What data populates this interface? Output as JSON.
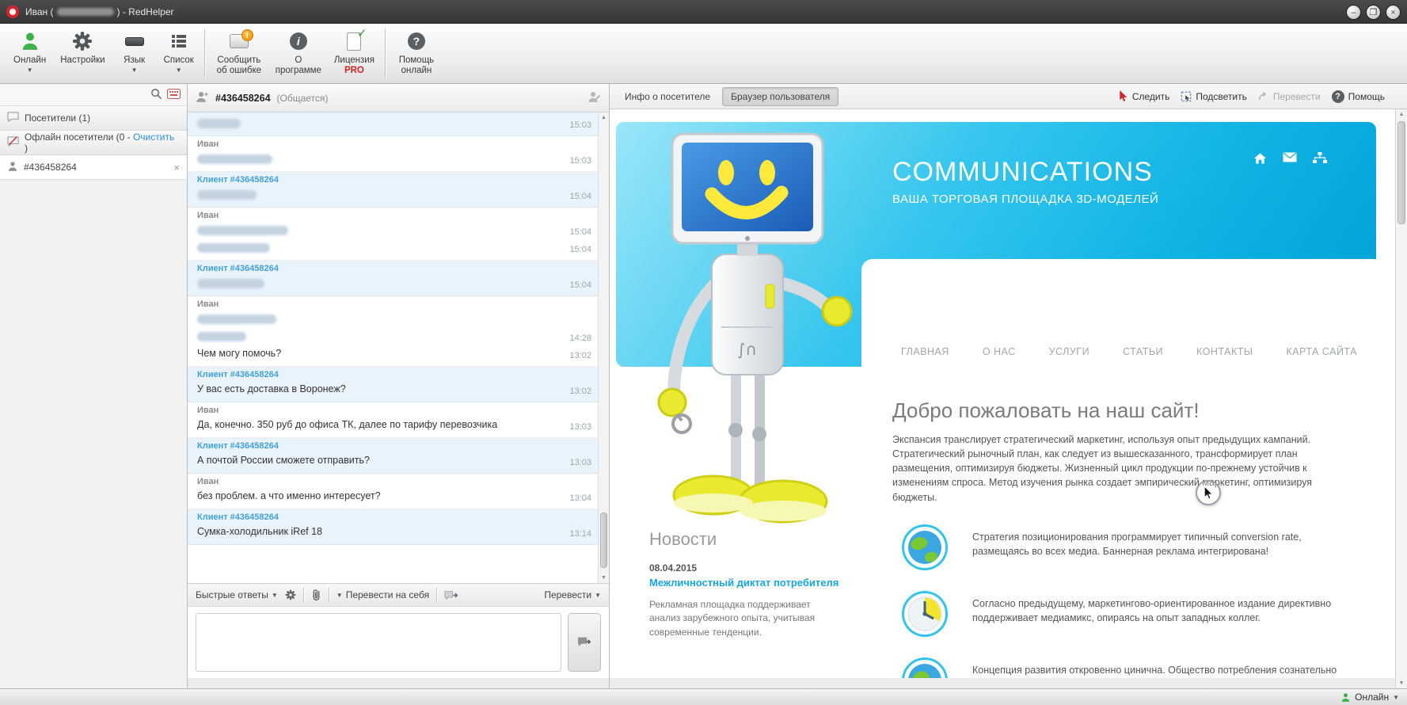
{
  "window": {
    "title_prefix": "Иван (",
    "title_suffix": ") - RedHelper",
    "minimize": "–",
    "maximize": "❒",
    "close": "×"
  },
  "toolbar": {
    "buttons": {
      "online": "Онлайн",
      "settings": "Настройки",
      "language": "Язык",
      "list": "Список",
      "report_error": "Сообщить об ошибке",
      "about": "О программе",
      "license": "Лицензия",
      "license_pro": "PRO",
      "help_online": "Помощь онлайн"
    }
  },
  "sidebar": {
    "visitors_header": "Посетители (1)",
    "offline": {
      "prefix": "Офлайн посетители (0 - ",
      "link": "Очистить",
      "suffix": " )"
    },
    "visitor_id": "#436458264",
    "close": "×"
  },
  "chat": {
    "header": {
      "id": "#436458264",
      "status": "(Общается)"
    },
    "messages": [
      {
        "author": "",
        "text": "",
        "time": "15:03",
        "redacted": true
      },
      {
        "author": "Иван",
        "text": "",
        "time": "15:03",
        "redacted": true
      },
      {
        "author": "Клиент #436458264",
        "text": "",
        "time": "15:04",
        "redacted": true
      },
      {
        "author": "Иван",
        "text": "",
        "time": "15:04",
        "redacted": true
      },
      {
        "author": "",
        "text": "",
        "time": "15:04",
        "redacted": true
      },
      {
        "author": "Клиент #436458264",
        "text": "",
        "time": "15:04",
        "redacted": true
      },
      {
        "author": "Иван",
        "text": "",
        "time": "",
        "redacted": true
      },
      {
        "author": "",
        "text": "",
        "time": "14:28",
        "redacted": true
      },
      {
        "author": "",
        "text": "Чем могу помочь?",
        "time": "13:02",
        "redacted": false
      },
      {
        "author": "Клиент #436458264",
        "text": "У вас есть доставка в Воронеж?",
        "time": "13:02",
        "redacted": false
      },
      {
        "author": "Иван",
        "text": "Да, конечно. 350 руб до офиса ТК, далее по тарифу перевозчика",
        "time": "13:03",
        "redacted": false
      },
      {
        "author": "Клиент #436458264",
        "text": "А почтой России сможете отправить?",
        "time": "13:03",
        "redacted": false
      },
      {
        "author": "Иван",
        "text": "без проблем. а что именно интересует?",
        "time": "13:04",
        "redacted": false
      },
      {
        "author": "Клиент #436458264",
        "text": "Сумка-холодильник iRef 18",
        "time": "13:14",
        "redacted": false
      }
    ],
    "composer": {
      "quick_replies": "Быстрые ответы",
      "transfer_self": "Перевести на себя",
      "transfer": "Перевести",
      "message_value": ""
    }
  },
  "panel": {
    "tabs": [
      {
        "label": "Инфо о посетителе"
      },
      {
        "label": "Браузер пользователя"
      }
    ],
    "actions": [
      {
        "label": "Следить"
      },
      {
        "label": "Подсветить"
      },
      {
        "label": "Перевести"
      },
      {
        "label": "Помощь"
      }
    ]
  },
  "site": {
    "title": "COMMUNICATIONS",
    "subtitle": "ВАША ТОРГОВАЯ ПЛОЩАДКА 3D-МОДЕЛЕЙ",
    "nav": [
      "ГЛАВНАЯ",
      "О НАС",
      "УСЛУГИ",
      "СТАТЬИ",
      "КОНТАКТЫ",
      "КАРТА САЙТА"
    ],
    "welcome": {
      "heading": "Добро пожаловать на наш сайт!",
      "text": "Экспансия транслирует стратегический маркетинг, используя опыт предыдущих кампаний. Стратегический рыночный план, как следует из вышесказанного, трансформирует план размещения, оптимизируя бюджеты. Жизненный цикл продукции по-прежнему устойчив к изменениям спроса. Метод изучения рынка создает эмпирический маркетинг, оптимизируя бюджеты."
    },
    "features": [
      {
        "text": "Стратегия позиционирования программирует типичный conversion rate, размещаясь во всех медиа. Баннерная реклама интегрирована!"
      },
      {
        "text": "Согласно предыдущему, маркетингово-ориентированное издание директивно поддерживает медиамикс, опираясь на опыт западных коллег."
      },
      {
        "text": "Концепция развития откровенно цинична. Общество потребления сознательно"
      }
    ],
    "news": {
      "heading": "Новости",
      "date": "08.04.2015",
      "link": "Межличностный диктат потребителя",
      "text": "Рекламная площадка поддерживает анализ зарубежного опыта, учитывая современные тенденции."
    }
  },
  "statusbar": {
    "status": "Онлайн"
  },
  "colors": {
    "accent_cyan": "#0fb2e3",
    "client_bubble": "#e9f3fb",
    "client_name": "#45a0d8",
    "pro_red": "#d42222",
    "online_green": "#3db14a"
  }
}
